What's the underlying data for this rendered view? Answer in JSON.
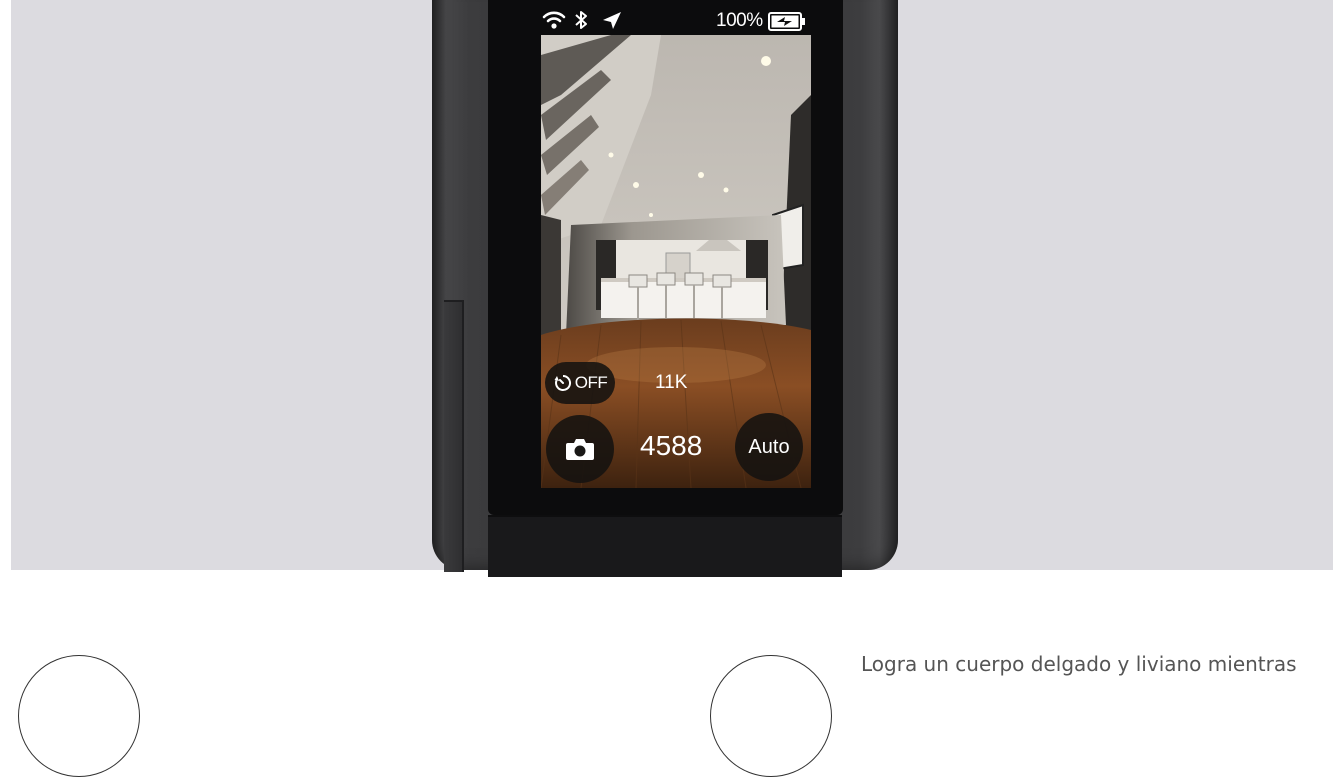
{
  "status_bar": {
    "battery_percent": "100%",
    "icons": [
      "wifi-icon",
      "bluetooth-icon",
      "location-arrow-icon",
      "battery-charging-icon"
    ]
  },
  "camera_overlay": {
    "timer_label": "OFF",
    "resolution": "11K",
    "shots_remaining": "4588",
    "mode_label": "Auto",
    "icons": [
      "timer-icon",
      "camera-icon"
    ]
  },
  "feature_section": {
    "text": "Logra un cuerpo delgado y liviano mientras"
  },
  "colors": {
    "hero_bg": "#dcdbe0",
    "camera_body": "#333335",
    "overlay_bg": "#141210"
  }
}
